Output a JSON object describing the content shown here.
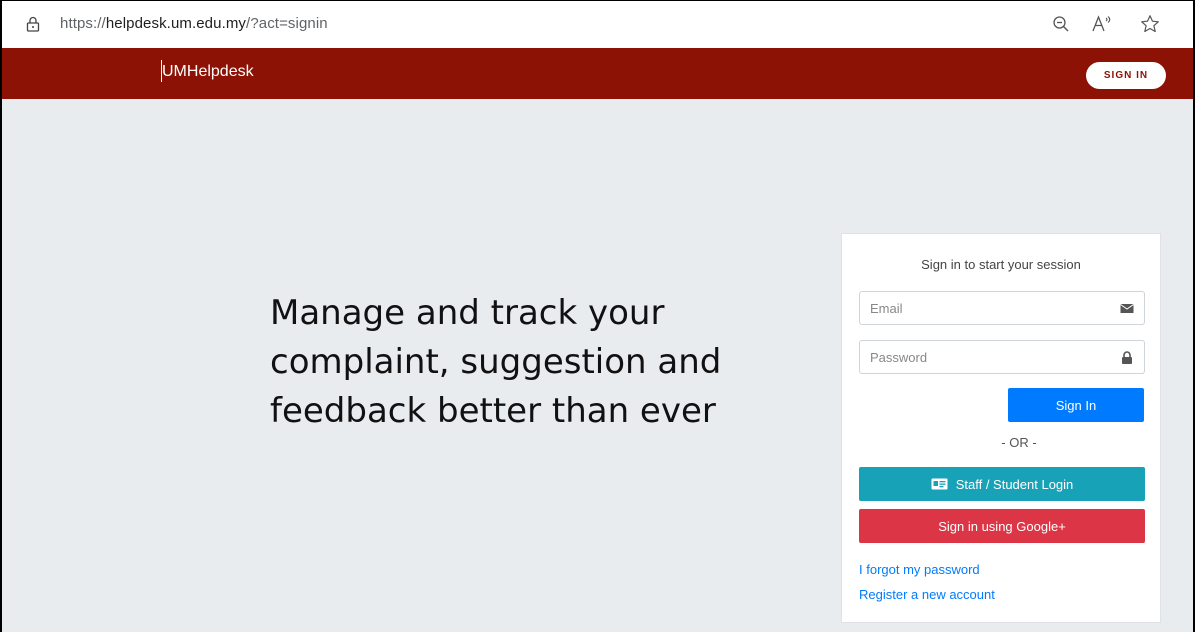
{
  "browser": {
    "url_prefix": "https://",
    "url_host": "helpdesk.um.edu.my",
    "url_path": "/?act=signin"
  },
  "navbar": {
    "brand": "UMHelpdesk",
    "signin_button": "SIGN IN",
    "color": "#8b1205"
  },
  "hero": {
    "headline": "Manage and track your complaint, suggestion and feedback better than ever"
  },
  "login": {
    "title": "Sign in to start your session",
    "email_placeholder": "Email",
    "password_placeholder": "Password",
    "signin_button": "Sign In",
    "or_text": "- OR -",
    "staff_button": "Staff / Student Login",
    "google_button": "Sign in using Google+",
    "forgot_link": "I forgot my password",
    "register_link": "Register a new account"
  },
  "icons": {
    "lock": "lock-icon",
    "zoom": "zoom-out-icon",
    "read_aloud": "read-aloud-icon",
    "favorite": "star-icon",
    "envelope": "envelope-icon",
    "padlock": "padlock-icon",
    "id_card": "id-card-icon"
  }
}
